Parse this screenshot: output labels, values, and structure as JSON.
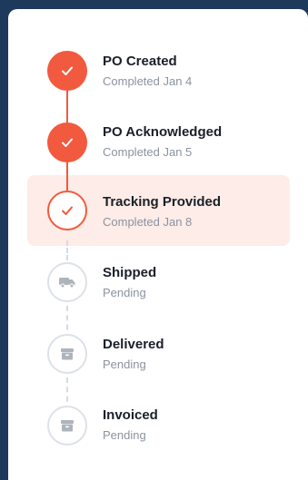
{
  "colors": {
    "background": "#1d3a5c",
    "card": "#ffffff",
    "accent": "#f15a3e",
    "highlight": "#fdece7",
    "pending_border": "#dde1e7",
    "pending_icon": "#aeb4bd"
  },
  "steps": [
    {
      "title": "PO Created",
      "status": "Completed Jan 4",
      "state": "completed",
      "icon": "check-icon"
    },
    {
      "title": "PO Acknowledged",
      "status": "Completed Jan 5",
      "state": "completed",
      "icon": "check-icon"
    },
    {
      "title": "Tracking Provided",
      "status": "Completed Jan 8",
      "state": "current",
      "icon": "check-icon"
    },
    {
      "title": "Shipped",
      "status": "Pending",
      "state": "pending",
      "icon": "truck-icon"
    },
    {
      "title": "Delivered",
      "status": "Pending",
      "state": "pending",
      "icon": "box-icon"
    },
    {
      "title": "Invoiced",
      "status": "Pending",
      "state": "pending",
      "icon": "invoice-icon"
    }
  ]
}
